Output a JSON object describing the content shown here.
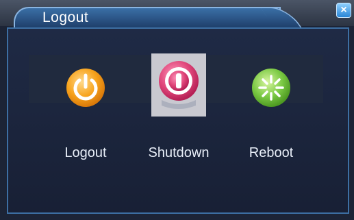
{
  "window": {
    "title": "Logout",
    "close_glyph": "×"
  },
  "actions": [
    {
      "label": "Logout",
      "icon": "power-icon",
      "color": "#f5a623"
    },
    {
      "label": "Shutdown",
      "icon": "shutdown-icon",
      "color": "#e0467a"
    },
    {
      "label": "Reboot",
      "icon": "reboot-icon",
      "color": "#7ac943"
    }
  ],
  "selected_action": "Shutdown"
}
